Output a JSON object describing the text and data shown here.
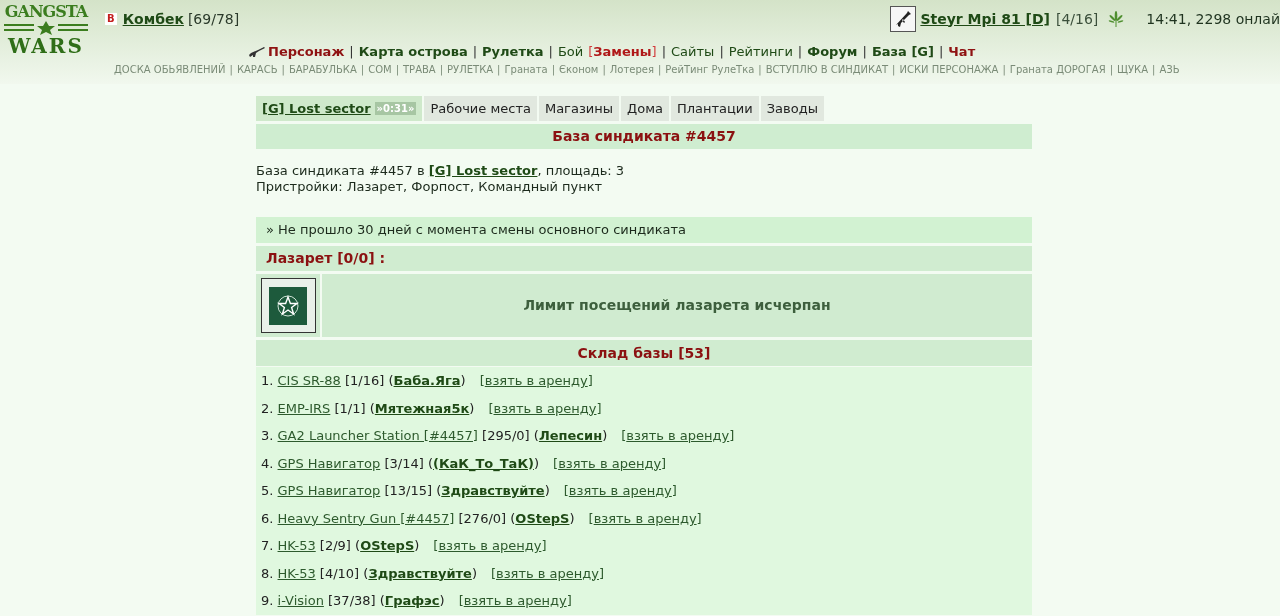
{
  "logo": {
    "top": "GANGSTA",
    "bottom": "WARS"
  },
  "user": {
    "badge": "B",
    "name": "Комбек",
    "count": "[69/78]"
  },
  "weapon": {
    "name": "Steyr Mpi 81 [D]",
    "count": "[4/16]"
  },
  "status": "14:41, 2298 онлай",
  "main_nav": [
    {
      "label": "Персонаж",
      "kind": "highlight",
      "separator": "|"
    },
    {
      "label": "Карта острова",
      "kind": "bold",
      "separator": "|"
    },
    {
      "label": "Рулетка",
      "kind": "bold",
      "separator": "|"
    },
    {
      "label": "Бой",
      "kind": "plain"
    },
    {
      "label": "[**Замены**]",
      "kind": "alert",
      "separator": "|"
    },
    {
      "label": "Сайты",
      "kind": "plain",
      "separator": "|"
    },
    {
      "label": "Рейтинги",
      "kind": "plain",
      "separator": "|"
    },
    {
      "label": "Форум",
      "kind": "bold",
      "separator": "|"
    },
    {
      "label": "База [G]",
      "kind": "bold",
      "separator": "|"
    },
    {
      "label": "Чат",
      "kind": "highlight"
    }
  ],
  "sub_nav": [
    {
      "label": "ДОСКА ОБЬЯВЛЕНИЙ",
      "separator": "|"
    },
    {
      "label": "КАРАСЬ",
      "separator": "|"
    },
    {
      "label": "БАРАБУЛЬКА",
      "separator": "|"
    },
    {
      "label": "СОМ",
      "separator": "|"
    },
    {
      "label": "ТРАВА",
      "separator": "|"
    },
    {
      "label": "РУЛЕТКА",
      "separator": "|"
    },
    {
      "label": "Граната",
      "separator": "|"
    },
    {
      "label": "Єконом",
      "separator": "|"
    },
    {
      "label": "Лотерея",
      "separator": "|"
    },
    {
      "label": "РейТинг РулеТка",
      "separator": "|"
    },
    {
      "label": "ВСТУПЛЮ В СИНДИКАТ",
      "separator": "|"
    },
    {
      "label": "ИСКИ ПЕРСОНАЖА",
      "separator": "|"
    },
    {
      "label": "Граната ДОРОГАЯ",
      "separator": "|"
    },
    {
      "label": "ЩУКА",
      "separator": "|"
    },
    {
      "label": "АЗЬ"
    }
  ],
  "tabs": [
    {
      "label": "[G] Lost sector",
      "badge": "»0:31»",
      "selected": true
    },
    {
      "label": "Рабочие места",
      "selected": false
    },
    {
      "label": "Магазины",
      "selected": false
    },
    {
      "label": "Дома",
      "selected": false
    },
    {
      "label": "Плантации",
      "selected": false
    },
    {
      "label": "Заводы",
      "selected": false
    }
  ],
  "base_title": "База синдиката #4457",
  "info": {
    "before": "База синдиката #4457 в",
    "link": "[G] Lost sector",
    "after": ", площадь: 3",
    "annexes": "Пристройки: Лазарет, Форпост, Командный пункт"
  },
  "notice": "» Не прошло 30 дней с момента смены основного синдиката",
  "infirmary": {
    "title": "Лазарет [0/0] :",
    "message": "Лимит посещений лазарета исчерпан"
  },
  "storage": {
    "title": "Склад базы [53]",
    "items": [
      {
        "number": "1.",
        "name": "CIS SR-88",
        "stats": "[1/16]",
        "owner_open": "(",
        "owner": "Баба.Яга",
        "owner_close": ")",
        "action_open": "[",
        "action": "взять в аренду",
        "action_close": "]"
      },
      {
        "number": "2.",
        "name": "EMP-IRS",
        "stats": "[1/1]",
        "owner_open": "(",
        "owner": "Мятежная5к",
        "owner_close": ")",
        "action_open": "[",
        "action": "взять в аренду",
        "action_close": "]"
      },
      {
        "number": "3.",
        "name": "GA2 Launcher Station [#4457]",
        "stats": "[295/0]",
        "owner_open": "(",
        "owner": "Лепесин",
        "owner_close": ")",
        "action_open": "[",
        "action": "взять в аренду",
        "action_close": "]"
      },
      {
        "number": "4.",
        "name": "GPS Навигатор",
        "stats": "[3/14]",
        "owner_open": "(",
        "owner": "(КаК_То_ТаК)",
        "owner_close": ")",
        "action_open": "[",
        "action": "взять в аренду",
        "action_close": "]"
      },
      {
        "number": "5.",
        "name": "GPS Навигатор",
        "stats": "[13/15]",
        "owner_open": "(",
        "owner": "Здравствуйте",
        "owner_close": ")",
        "action_open": "[",
        "action": "взять в аренду",
        "action_close": "]"
      },
      {
        "number": "6.",
        "name": "Heavy Sentry Gun [#4457]",
        "stats": "[276/0]",
        "owner_open": "(",
        "owner": "OStepS",
        "owner_close": ")",
        "action_open": "[",
        "action": "взять в аренду",
        "action_close": "]"
      },
      {
        "number": "7.",
        "name": "HK-53",
        "stats": "[2/9]",
        "owner_open": "(",
        "owner": "OStepS",
        "owner_close": ")",
        "action_open": "[",
        "action": "взять в аренду",
        "action_close": "]"
      },
      {
        "number": "8.",
        "name": "HK-53",
        "stats": "[4/10]",
        "owner_open": "(",
        "owner": "Здравствуйте",
        "owner_close": ")",
        "action_open": "[",
        "action": "взять в аренду",
        "action_close": "]"
      },
      {
        "number": "9.",
        "name": "i-Vision",
        "stats": "[37/38]",
        "owner_open": "(",
        "owner": "Графэс",
        "owner_close": ")",
        "action_open": "[",
        "action": "взять в аренду",
        "action_close": "]"
      }
    ]
  }
}
